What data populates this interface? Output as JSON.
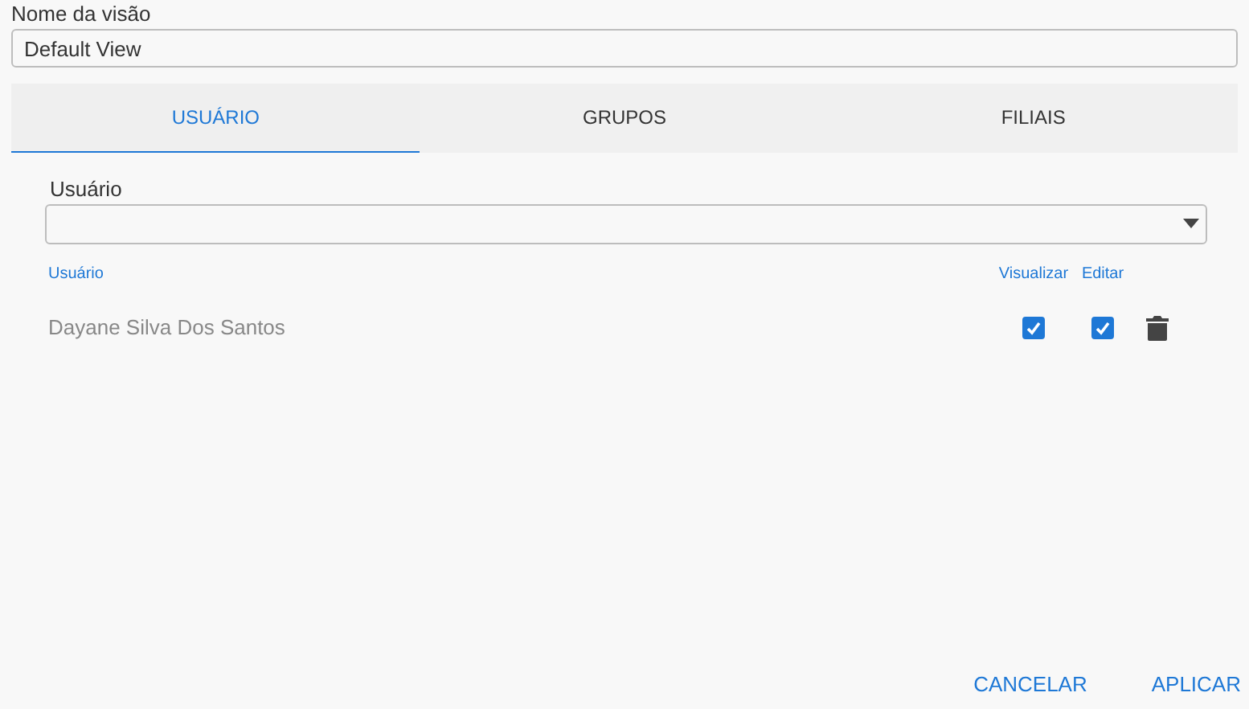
{
  "view_name": {
    "label": "Nome da visão",
    "value": "Default View"
  },
  "tabs": [
    {
      "label": "USUÁRIO",
      "selected": true
    },
    {
      "label": "GRUPOS",
      "selected": false
    },
    {
      "label": "FILIAIS",
      "selected": false
    }
  ],
  "user_select": {
    "label": "Usuário"
  },
  "table": {
    "columns": [
      "Usuário",
      "Visualizar",
      "Editar"
    ],
    "rows": [
      {
        "name": "Dayane Silva Dos Santos",
        "view": true,
        "edit": true
      }
    ]
  },
  "buttons": [
    "CANCELAR",
    "APLICAR"
  ]
}
